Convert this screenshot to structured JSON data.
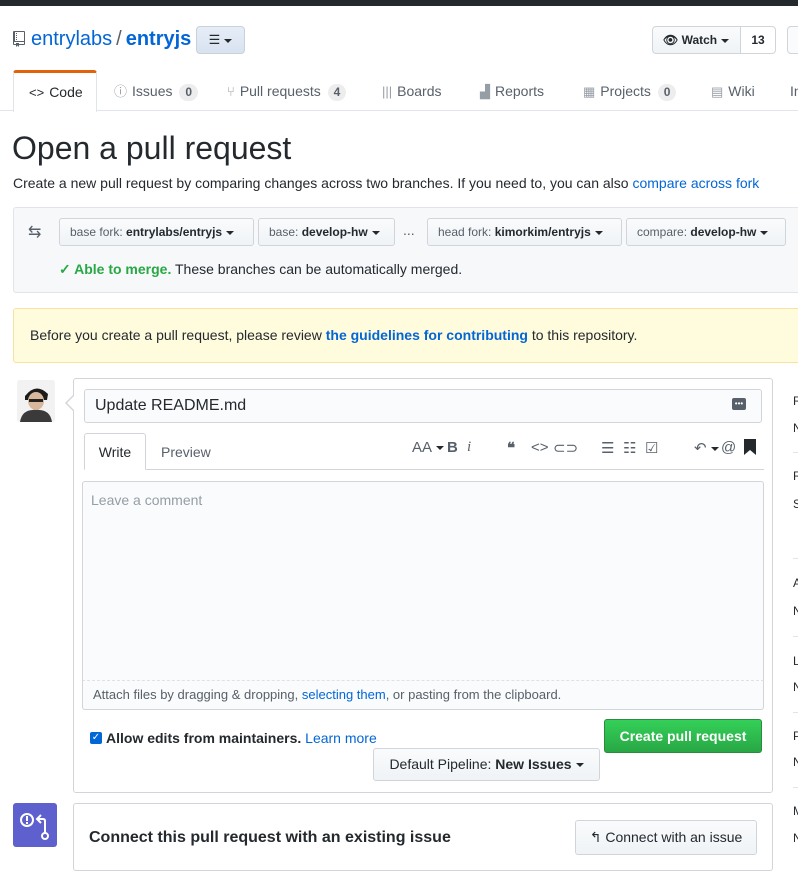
{
  "header": {
    "owner": "entrylabs",
    "separator": "/",
    "repo": "entryjs",
    "watch_label": "Watch",
    "watch_count": "13"
  },
  "tabs": [
    {
      "label": "Code",
      "icon": "code-icon"
    },
    {
      "label": "Issues",
      "count": "0",
      "icon": "issue-icon"
    },
    {
      "label": "Pull requests",
      "count": "4",
      "icon": "pull-request-icon"
    },
    {
      "label": "Boards",
      "icon": "boards-icon"
    },
    {
      "label": "Reports",
      "icon": "graph-icon"
    },
    {
      "label": "Projects",
      "count": "0",
      "icon": "project-icon"
    },
    {
      "label": "Wiki",
      "icon": "book-icon"
    },
    {
      "label": "In"
    }
  ],
  "page": {
    "title": "Open a pull request",
    "subtitle": "Create a new pull request by comparing changes across two branches. If you need to, you can also",
    "subtitle_link": "compare across fork"
  },
  "range": {
    "base_fork_label": "base fork:",
    "base_fork": "entrylabs/entryjs",
    "base_label": "base:",
    "base": "develop-hw",
    "ellipsis": "...",
    "head_fork_label": "head fork:",
    "head_fork": "kimorkim/entryjs",
    "compare_label": "compare:",
    "compare": "develop-hw",
    "merge_status": "✓ Able to merge.",
    "merge_text": "These branches can be automatically merged."
  },
  "flash": {
    "before": "Before you create a pull request, please review",
    "link": "the guidelines for contributing",
    "after": "to this repository."
  },
  "form": {
    "title_value": "Update README.md",
    "write_tab": "Write",
    "preview_tab": "Preview",
    "comment_placeholder": "Leave a comment",
    "drop_before": "Attach files by dragging & dropping,",
    "drop_link": "selecting them",
    "drop_after": ", or pasting from the clipboard.",
    "allow_label": "Allow edits from maintainers.",
    "learn_more": "Learn more",
    "create_button": "Create pull request",
    "pipeline_label": "Default Pipeline:",
    "pipeline_value": "New Issues"
  },
  "connect": {
    "label": "Connect this pull request with an existing issue",
    "button": "Connect with an issue"
  },
  "colors": {
    "accent": "#0366d6",
    "success": "#28a745",
    "tab_active": "#e36209",
    "zenhub": "#5e60ce"
  }
}
